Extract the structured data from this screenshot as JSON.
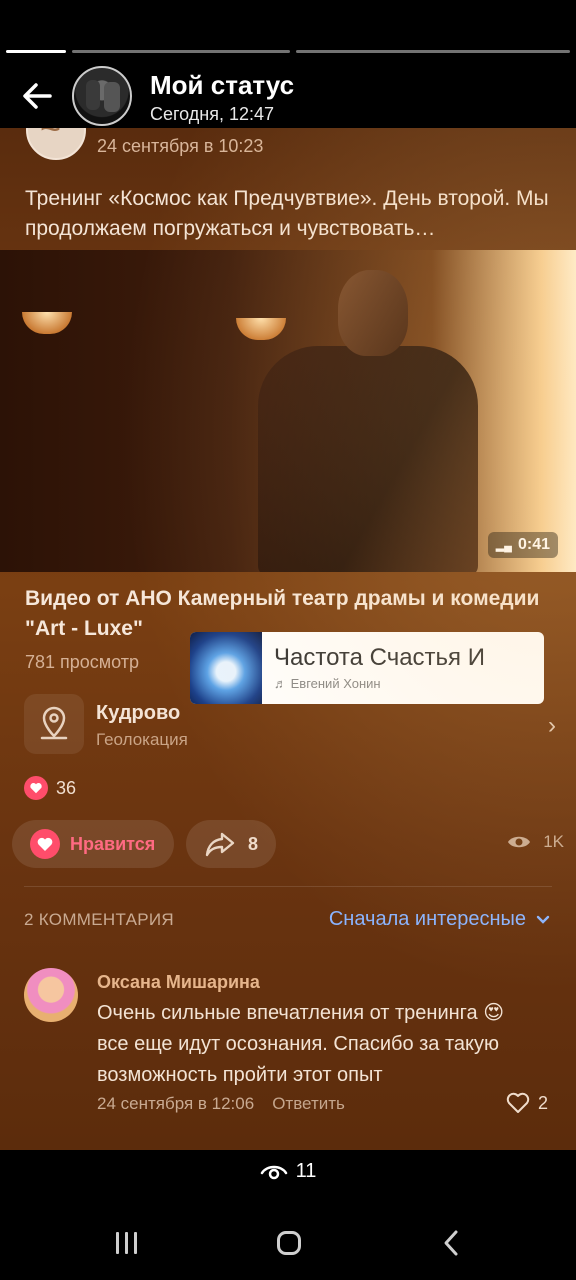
{
  "header": {
    "title": "Мой статус",
    "subtitle": "Сегодня, 12:47"
  },
  "post": {
    "date": "24 сентября в 10:23",
    "text": "Тренинг «Космос как Предчувтвие». День второй. Мы продолжаем погружаться и чувствовать…",
    "video_duration": "0:41",
    "video_title": "Видео от АНО Камерный театр драмы и комедии \"Art - Luxe\"",
    "views": "781 просмотр"
  },
  "music": {
    "song": "Частота Счастья И",
    "artist": "♬ Евгений Хонин"
  },
  "geo": {
    "name": "Кудрово",
    "label": "Геолокация"
  },
  "reactions": {
    "likes": "36",
    "like_label": "Нравится",
    "shares": "8",
    "views": "1K"
  },
  "comments": {
    "header": "2 КОММЕНТАРИЯ",
    "sort": "Сначала интересные",
    "items": [
      {
        "author": "Оксана Мишарина",
        "text": "Очень сильные впечатления от тренинга 😍 все еще идут осознания. Спасибо за такую возможность пройти этот опыт",
        "date": "24 сентября в 12:06",
        "reply": "Ответить",
        "likes": "2"
      }
    ]
  },
  "footer": {
    "views": "11"
  },
  "colors": {
    "accent_link": "#8ab4ff",
    "like_red": "#ff4d6b"
  }
}
